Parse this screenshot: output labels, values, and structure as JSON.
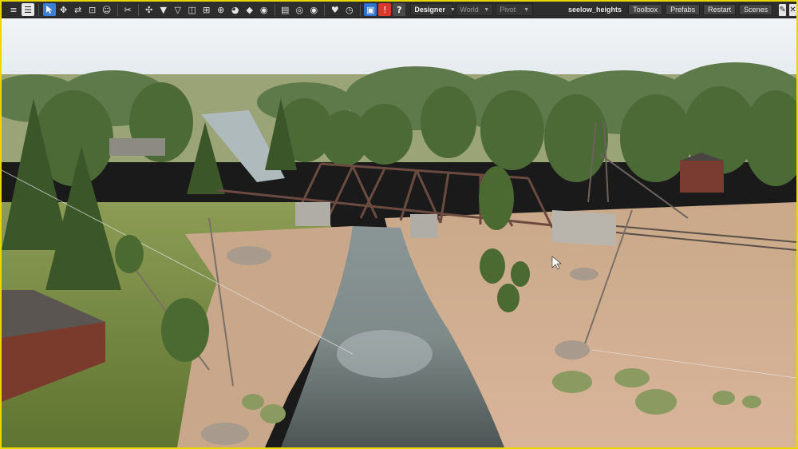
{
  "toolbar": {
    "mode_dropdown": {
      "value": "Designer"
    },
    "space_dropdown": {
      "value": "World"
    },
    "pivot_dropdown": {
      "value": "Pivot"
    },
    "scene_name": "seelow_heights",
    "buttons": {
      "toolbox": "Toolbox",
      "prefabs": "Prefabs",
      "restart": "Restart",
      "scenes": "Scenes"
    },
    "icons": [
      "menu-icon",
      "list-icon",
      "select-icon",
      "move-icon",
      "link-icon",
      "scale-icon",
      "smile-icon",
      "cut-icon",
      "snap-icon",
      "drop-down-icon",
      "drop-up-icon",
      "split-icon",
      "node-icon",
      "crosshair-icon",
      "paint-icon",
      "marker-icon",
      "diamond-icon",
      "badge-icon",
      "document-icon",
      "eye-off-icon",
      "eye-icon",
      "heart-icon",
      "timer-icon",
      "save-icon",
      "warning-icon",
      "help-icon",
      "wrench-icon",
      "close-icon"
    ],
    "help_label": "?",
    "warning_label": "!"
  },
  "viewport": {
    "description_colors": {
      "sky": "#e8eef3",
      "water": "#6f7a7c",
      "sand": "#cfa98a",
      "grass": "#8f9e5a",
      "trees": "#4e6b3a"
    }
  }
}
